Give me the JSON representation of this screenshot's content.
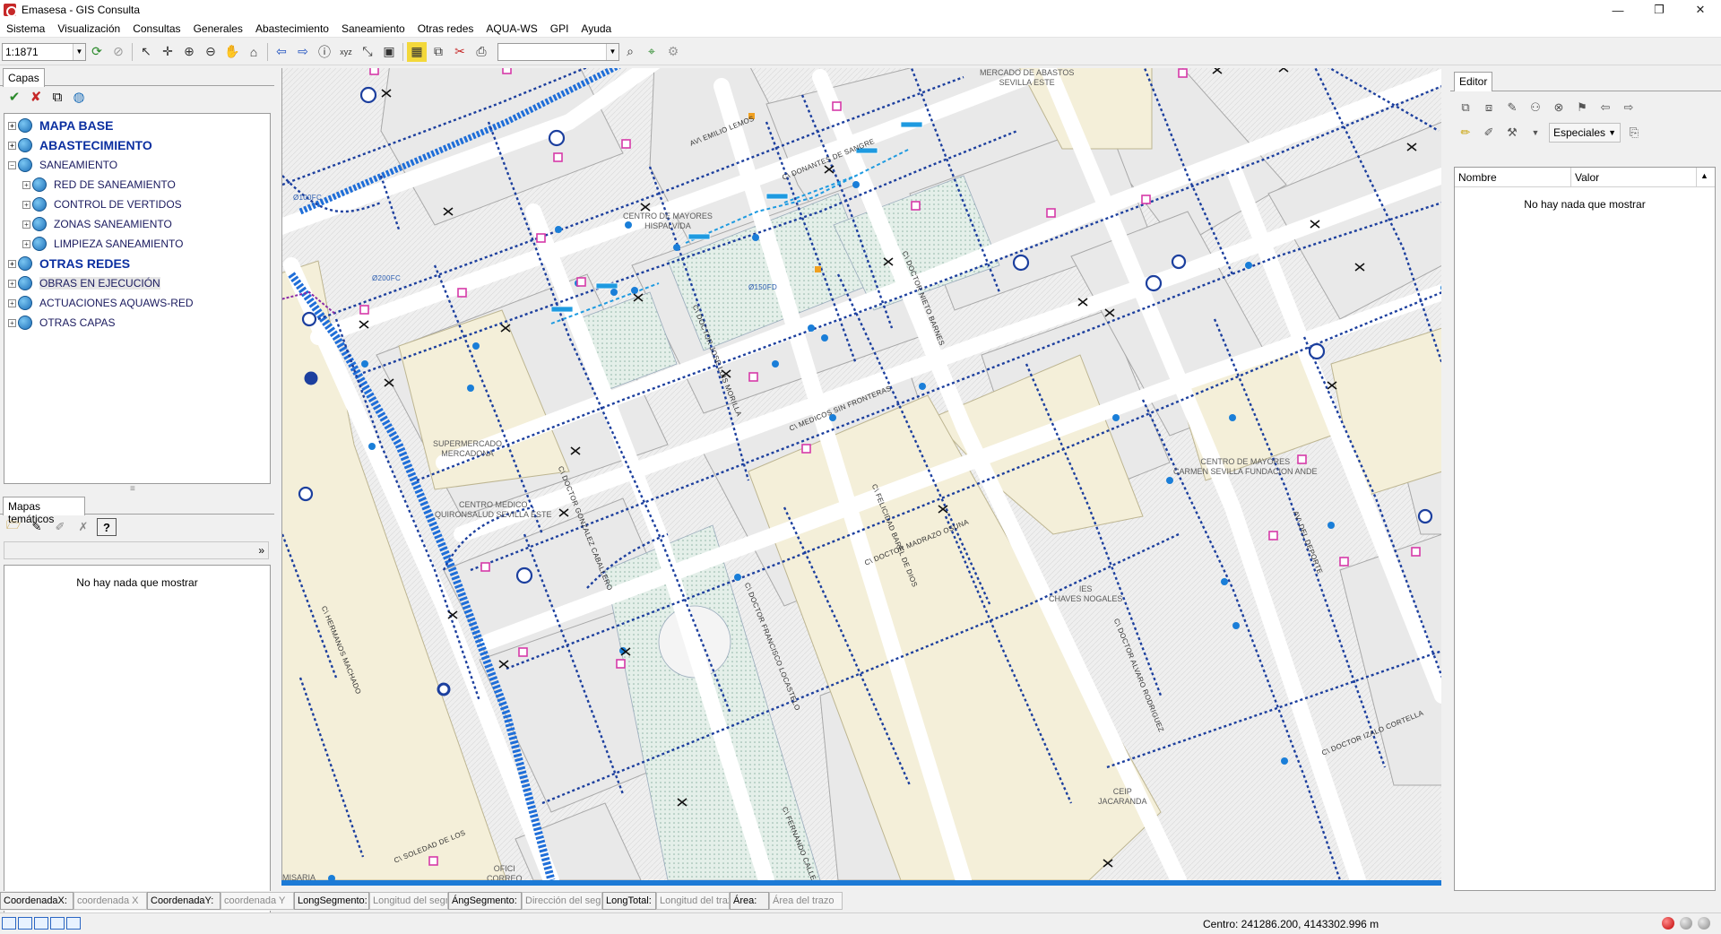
{
  "window": {
    "title": "Emasesa - GIS Consulta",
    "minimize": "—",
    "maximize": "❐",
    "close": "✕"
  },
  "menu": [
    "Sistema",
    "Visualización",
    "Consultas",
    "Generales",
    "Abastecimiento",
    "Saneamiento",
    "Otras redes",
    "AQUA-WS",
    "GPI",
    "Ayuda"
  ],
  "toolbar": {
    "scale_value": "1:1871",
    "search_value": ""
  },
  "layers_panel": {
    "tab": "Capas",
    "items": [
      {
        "label": "MAPA BASE",
        "level": 1,
        "expander": "+"
      },
      {
        "label": "ABASTECIMIENTO",
        "level": 1,
        "expander": "+"
      },
      {
        "label": "SANEAMIENTO",
        "level": 1,
        "expander": "−"
      },
      {
        "label": "RED DE SANEAMIENTO",
        "level": 2,
        "expander": "+"
      },
      {
        "label": "CONTROL DE VERTIDOS",
        "level": 2,
        "expander": "+"
      },
      {
        "label": "ZONAS SANEAMIENTO",
        "level": 2,
        "expander": "+"
      },
      {
        "label": "LIMPIEZA SANEAMIENTO",
        "level": 2,
        "expander": "+"
      },
      {
        "label": "OTRAS REDES",
        "level": 1,
        "expander": "+"
      },
      {
        "label": "OBRAS EN EJECUCIÓN",
        "level": 1,
        "expander": "+"
      },
      {
        "label": "ACTUACIONES AQUAWS-RED",
        "level": 1,
        "expander": "+"
      },
      {
        "label": "OTRAS CAPAS",
        "level": 1,
        "expander": "+"
      }
    ]
  },
  "thematic_panel": {
    "tab": "Mapas temáticos",
    "empty": "No hay nada que mostrar"
  },
  "editor_panel": {
    "tab": "Editor",
    "especiales": "Especiales",
    "col_name": "Nombre",
    "col_value": "Valor",
    "empty": "No hay nada que mostrar"
  },
  "map": {
    "places": {
      "mercado": "MERCADO DE ABASTOS\nSEVILLA ESTE",
      "hispalvida": "CENTRO DE MAYORES\nHISPALVIDA",
      "mercadona": "SUPERMERCADO\nMERCADONA",
      "quironsalud": "CENTRO MEDICO\nQUIRONSALUD SEVILLA ESTE",
      "fundacion": "CENTRO DE MAYORES\nCARMEN SEVILLA FUNDACION ANDE",
      "ies": "IES\nCHAVES NOGALES",
      "ceip": "CEIP\nJACARANDA",
      "oficina": "OFICI\nCORREO",
      "misaria": "MISARIA"
    },
    "streets": {
      "emilio_lemos": "AV\\ EMILIO LEMOS",
      "nantes": "C\\ DONANTES DE SANGRE",
      "medicos": "C\\ MEDICOS SIN FRONTERAS",
      "madrazo": "C\\ DOCTOR MADRAZO OSUNA",
      "cabello": "C\\ DOCTOR GONZALEZ CABALLERO",
      "felicidad": "C\\ FELICIDAD BAREL DE DIOS",
      "doctor_fernandez": "C\\ DOCTOR FRANCISCO LOCASTELO",
      "doctor_nieto": "C\\ DOCTOR NIETO BARNES",
      "doctor_jose": "C\\ DOCTOR JOSE LUIS MORILLA",
      "deporte": "AV\\ DEL DEPORTE",
      "cortella": "C\\ DOCTOR IZALO CORTELLA",
      "doctor_alvaro": "C\\ DOCTOR ALVARO RODRIGUEZ",
      "fernando": "C\\ FERNANDO CALLEJO ROSALES",
      "ledesma": "C\\ SOLEDAD DE LOS",
      "dos_hermanas": "C\\ HERMANOS MACHADO",
      "pipe1": "Ø200FC",
      "pipe2": "Ø150FD",
      "pipe3": "Ø100FC"
    }
  },
  "coords": [
    {
      "label": "CoordenadaX:",
      "placeholder": "coordenada X"
    },
    {
      "label": "CoordenadaY:",
      "placeholder": "coordenada Y"
    },
    {
      "label": "LongSegmento:",
      "placeholder": "Longitud del segm"
    },
    {
      "label": "ÁngSegmento:",
      "placeholder": "Dirección del segm"
    },
    {
      "label": "LongTotal:",
      "placeholder": "Longitud del trazo"
    },
    {
      "label": "Área:",
      "placeholder": "Área del trazo"
    }
  ],
  "status": {
    "center": "Centro: 241286.200, 4143302.996 m"
  },
  "colors": {
    "accent": "#1c7ad6",
    "pipe": "#1a3fae",
    "manhole": "#d63aa8",
    "block": "#f5f0dc",
    "park": "#cfe3dc"
  }
}
